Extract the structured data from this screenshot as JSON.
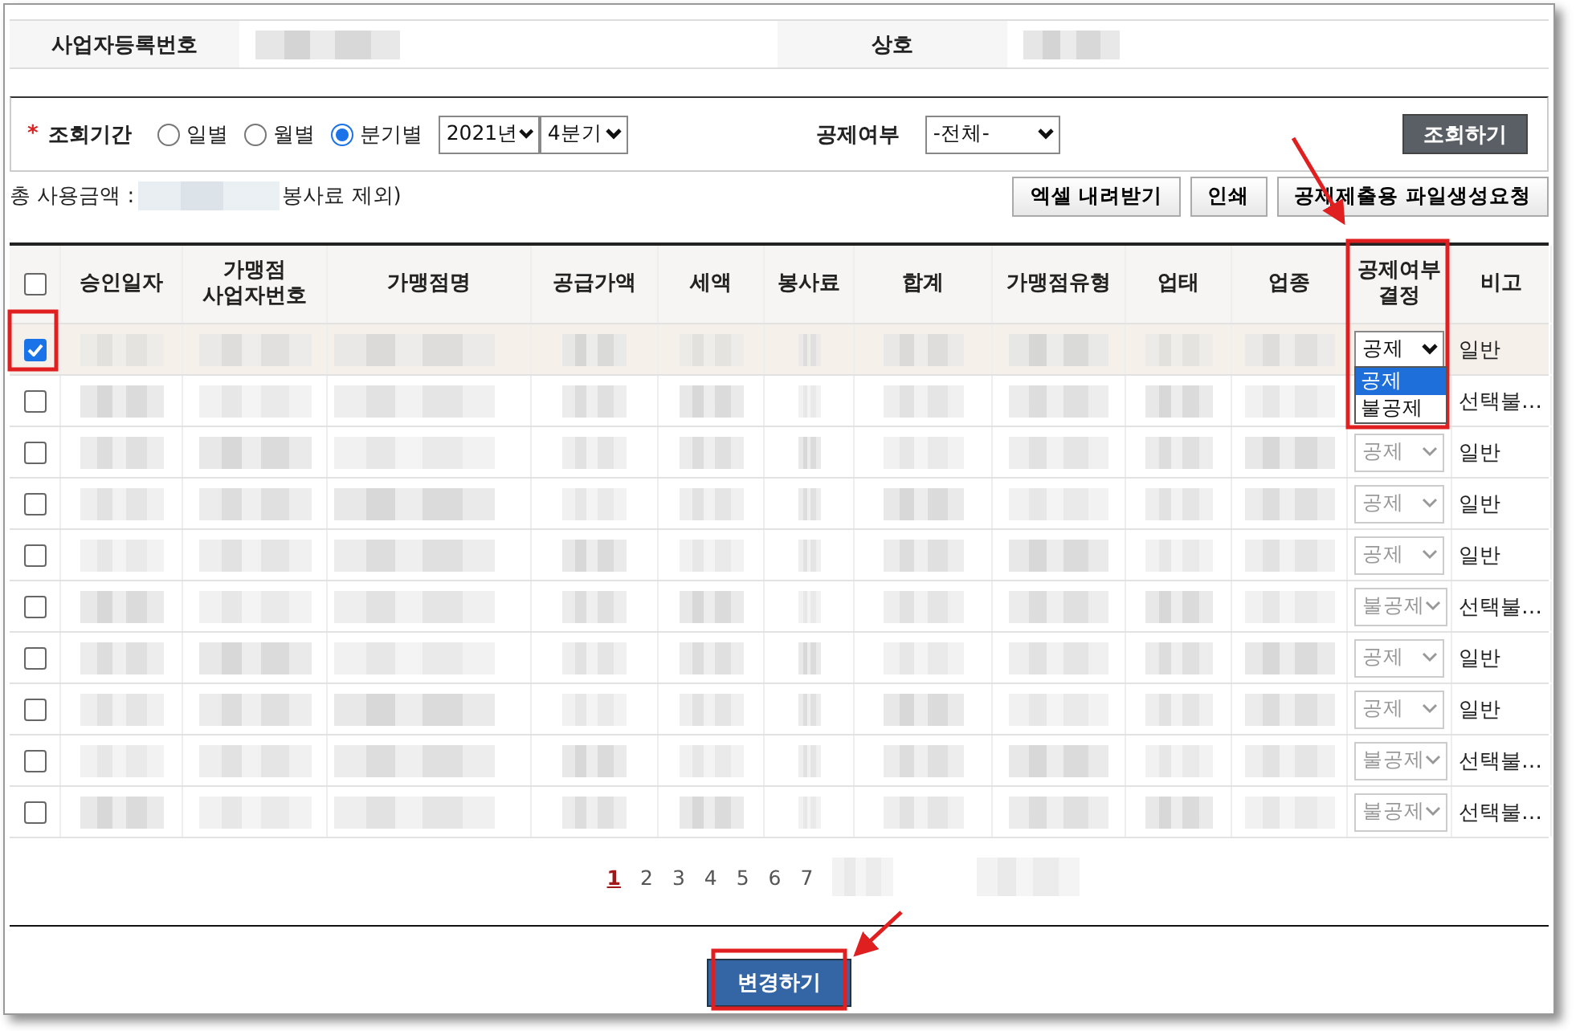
{
  "business_info": [
    {
      "label": "사업자등록번호"
    },
    {
      "label": "상호"
    }
  ],
  "search": {
    "required_mark": "*",
    "period_label": "조회기간",
    "period_options": [
      {
        "label": "일별",
        "selected": false
      },
      {
        "label": "월별",
        "selected": false
      },
      {
        "label": "분기별",
        "selected": true
      }
    ],
    "year": "2021년",
    "quarter": "4분기",
    "deduction_label": "공제여부",
    "deduction_value": "-전체-",
    "search_button": "조회하기"
  },
  "summary": {
    "total_label": "총 사용금액 :",
    "total_suffix": "봉사료 제외)"
  },
  "actions": [
    {
      "label": "엑셀 내려받기"
    },
    {
      "label": "인쇄"
    },
    {
      "label": "공제제출용 파일생성요청"
    }
  ],
  "table": {
    "all_checked": false,
    "columns": [
      "승인일자",
      "가맹점\n사업자번호",
      "가맹점명",
      "공급가액",
      "세액",
      "봉사료",
      "합계",
      "가맹점유형",
      "업태",
      "업종",
      "공제여부\n결정",
      "비고"
    ],
    "rows": [
      {
        "checked": true,
        "decision": "공제",
        "disabled": false,
        "note": "일반",
        "options": [
          {
            "label": "공제",
            "selected": true
          },
          {
            "label": "불공제",
            "selected": false
          }
        ]
      },
      {
        "checked": false,
        "note": "선택불…"
      },
      {
        "checked": false,
        "decision": "공제",
        "disabled": true,
        "note": "일반"
      },
      {
        "checked": false,
        "decision": "공제",
        "disabled": true,
        "note": "일반"
      },
      {
        "checked": false,
        "decision": "공제",
        "disabled": true,
        "note": "일반"
      },
      {
        "checked": false,
        "decision": "불공제",
        "disabled": true,
        "note": "선택불…"
      },
      {
        "checked": false,
        "decision": "공제",
        "disabled": true,
        "note": "일반"
      },
      {
        "checked": false,
        "decision": "공제",
        "disabled": true,
        "note": "일반"
      },
      {
        "checked": false,
        "decision": "불공제",
        "disabled": true,
        "note": "선택불…"
      },
      {
        "checked": false,
        "decision": "불공제",
        "disabled": true,
        "note": "선택불…"
      }
    ]
  },
  "pagination": [
    {
      "label": "1",
      "selected": true
    },
    {
      "label": "2",
      "selected": false
    },
    {
      "label": "3",
      "selected": false
    },
    {
      "label": "4",
      "selected": false
    },
    {
      "label": "5",
      "selected": false
    },
    {
      "label": "6",
      "selected": false
    },
    {
      "label": "7",
      "selected": false
    }
  ],
  "submit_button": "변경하기"
}
